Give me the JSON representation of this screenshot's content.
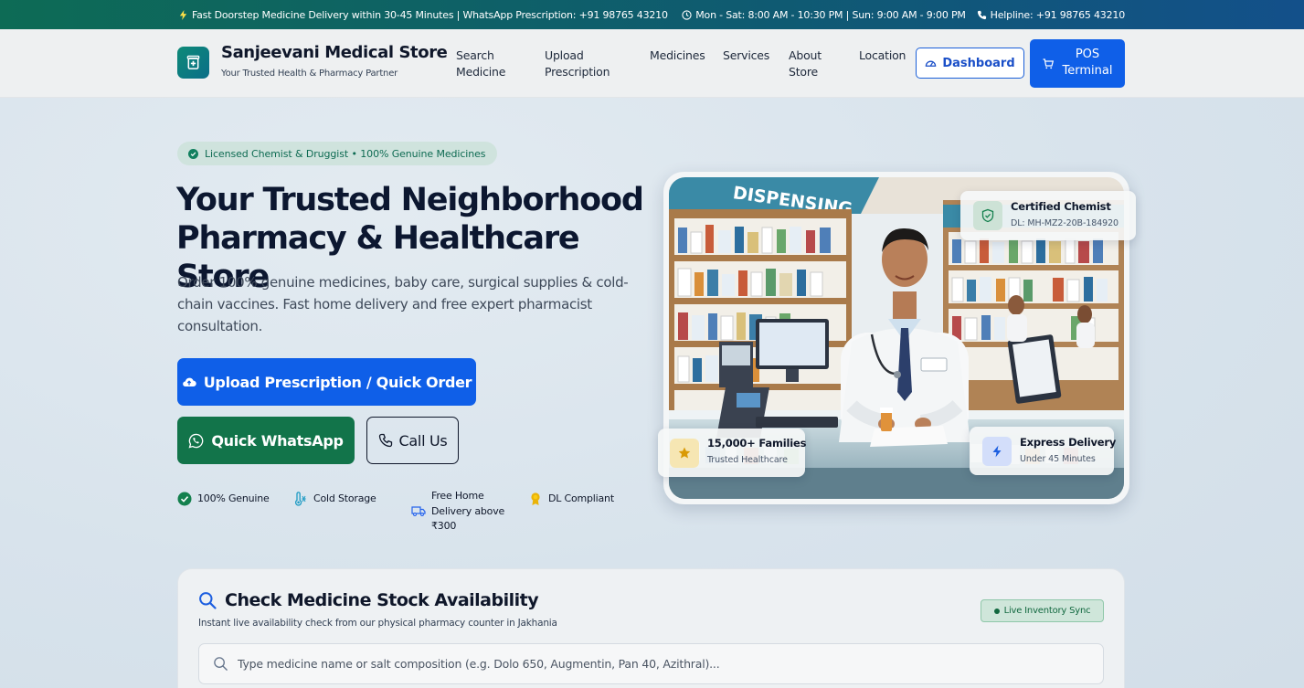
{
  "topbar": {
    "left_text": "Fast Doorstep Medicine Delivery within 30-45 Minutes | WhatsApp Prescription: +91 98765 43210",
    "hours_text": "Mon - Sat: 8:00 AM - 10:30 PM | Sun: 9:00 AM - 9:00 PM",
    "helpline_text": "Helpline: +91 98765 43210"
  },
  "header": {
    "brand_name": "Sanjeevani Medical Store",
    "brand_tagline": "Your Trusted Health & Pharmacy Partner",
    "nav": {
      "search_line1": "Search",
      "search_line2": "Medicine",
      "upload_line1": "Upload",
      "upload_line2": "Prescription",
      "medicines": "Medicines",
      "services": "Services",
      "about_line1": "About",
      "about_line2": "Store",
      "location": "Location"
    },
    "dashboard_label": "Dashboard",
    "pos_line1": "POS",
    "pos_line2": "Terminal"
  },
  "hero": {
    "badge": "Licensed Chemist & Druggist • 100% Genuine Medicines",
    "title_line1": "Your Trusted Neighborhood",
    "title_line2": "Pharmacy & Healthcare Store",
    "description": "Order 100% genuine medicines, baby care, surgical supplies & cold-chain vaccines. Fast home delivery and free expert pharmacist consultation.",
    "upload_button": "Upload Prescription / Quick Order",
    "whatsapp_button": "Quick WhatsApp",
    "call_button": "Call Us",
    "features": {
      "genuine": "100% Genuine",
      "cold": "Cold Storage",
      "delivery_line1": "Free Home",
      "delivery_line2": "Delivery above",
      "delivery_line3": "₹300",
      "dl": "DL Compliant"
    },
    "cards": {
      "certified_title": "Certified Chemist",
      "certified_sub": "DL: MH-MZ2-20B-184920",
      "families_title": "15,000+ Families",
      "families_sub": "Trusted Healthcare",
      "express_title": "Express Delivery",
      "express_sub": "Under 45 Minutes"
    },
    "photo_sign": "DISPENSING"
  },
  "stock": {
    "title": "Check Medicine Stock Availability",
    "subtitle": "Instant live availability check from our physical pharmacy counter in Jakhania",
    "live_badge": "Live Inventory Sync",
    "search_placeholder": "Type medicine name or salt composition (e.g. Dolo 650, Augmentin, Pan 40, Azithral)..."
  },
  "colors": {
    "primary_blue": "#0f5fe8",
    "whatsapp_green": "#12744a",
    "brand_teal": "#0e8a78",
    "topbar_start": "#0d6b55",
    "topbar_end": "#13508a"
  },
  "icons": {
    "logo": "medical-cross-icon",
    "dashboard": "speedometer-icon",
    "pos": "cart-icon",
    "upload": "cloud-upload-icon",
    "whatsapp": "whatsapp-icon",
    "call": "phone-icon",
    "search": "search-icon"
  }
}
